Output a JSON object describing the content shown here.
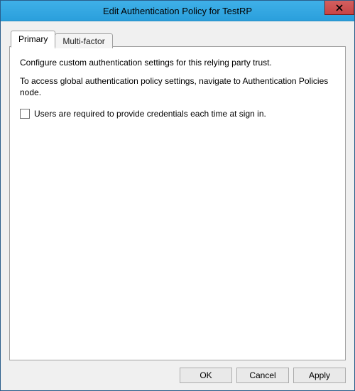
{
  "window": {
    "title": "Edit Authentication Policy for TestRP"
  },
  "tabs": {
    "primary": {
      "label": "Primary"
    },
    "multifactor": {
      "label": "Multi-factor"
    }
  },
  "primary_page": {
    "line1": "Configure custom authentication settings for this relying party trust.",
    "line2": "To access global authentication policy settings, navigate to Authentication Policies node.",
    "checkbox_label": "Users are required to provide credentials each time at sign in.",
    "checkbox_checked": false
  },
  "buttons": {
    "ok": "OK",
    "cancel": "Cancel",
    "apply": "Apply"
  }
}
